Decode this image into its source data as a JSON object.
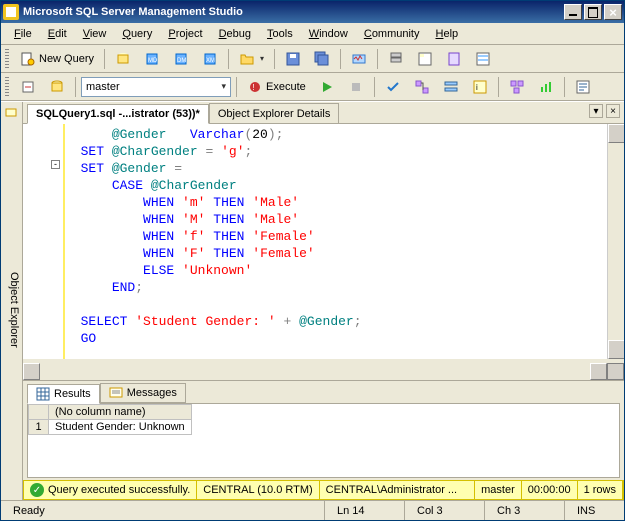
{
  "window": {
    "title": "Microsoft SQL Server Management Studio"
  },
  "menu": {
    "file": "File",
    "edit": "Edit",
    "view": "View",
    "query": "Query",
    "project": "Project",
    "debug": "Debug",
    "tools": "Tools",
    "window": "Window",
    "community": "Community",
    "help": "Help"
  },
  "toolbar1": {
    "new_query": "New Query"
  },
  "toolbar2": {
    "database": "master",
    "execute": "Execute"
  },
  "sidebar": {
    "object_explorer": "Object Explorer"
  },
  "tabs": {
    "active": "SQLQuery1.sql -...istrator (53))*",
    "inactive": "Object Explorer Details"
  },
  "editor": {
    "lines": [
      {
        "indent": 3,
        "tokens": [
          {
            "t": "var",
            "v": "@Gender"
          },
          {
            "t": "plain",
            "v": "   "
          },
          {
            "t": "kw",
            "v": "Varchar"
          },
          {
            "t": "gray",
            "v": "("
          },
          {
            "t": "plain",
            "v": "20"
          },
          {
            "t": "gray",
            "v": ");"
          }
        ]
      },
      {
        "indent": 1,
        "tokens": [
          {
            "t": "kw",
            "v": "SET"
          },
          {
            "t": "plain",
            "v": " "
          },
          {
            "t": "var",
            "v": "@CharGender"
          },
          {
            "t": "plain",
            "v": " "
          },
          {
            "t": "gray",
            "v": "="
          },
          {
            "t": "plain",
            "v": " "
          },
          {
            "t": "str",
            "v": "'g'"
          },
          {
            "t": "gray",
            "v": ";"
          }
        ]
      },
      {
        "indent": 1,
        "collapse": true,
        "tokens": [
          {
            "t": "kw",
            "v": "SET"
          },
          {
            "t": "plain",
            "v": " "
          },
          {
            "t": "var",
            "v": "@Gender"
          },
          {
            "t": "plain",
            "v": " "
          },
          {
            "t": "gray",
            "v": "="
          }
        ]
      },
      {
        "indent": 3,
        "tokens": [
          {
            "t": "kw",
            "v": "CASE"
          },
          {
            "t": "plain",
            "v": " "
          },
          {
            "t": "var",
            "v": "@CharGender"
          }
        ]
      },
      {
        "indent": 5,
        "tokens": [
          {
            "t": "kw",
            "v": "WHEN"
          },
          {
            "t": "plain",
            "v": " "
          },
          {
            "t": "str",
            "v": "'m'"
          },
          {
            "t": "plain",
            "v": " "
          },
          {
            "t": "kw",
            "v": "THEN"
          },
          {
            "t": "plain",
            "v": " "
          },
          {
            "t": "str",
            "v": "'Male'"
          }
        ]
      },
      {
        "indent": 5,
        "tokens": [
          {
            "t": "kw",
            "v": "WHEN"
          },
          {
            "t": "plain",
            "v": " "
          },
          {
            "t": "str",
            "v": "'M'"
          },
          {
            "t": "plain",
            "v": " "
          },
          {
            "t": "kw",
            "v": "THEN"
          },
          {
            "t": "plain",
            "v": " "
          },
          {
            "t": "str",
            "v": "'Male'"
          }
        ]
      },
      {
        "indent": 5,
        "tokens": [
          {
            "t": "kw",
            "v": "WHEN"
          },
          {
            "t": "plain",
            "v": " "
          },
          {
            "t": "str",
            "v": "'f'"
          },
          {
            "t": "plain",
            "v": " "
          },
          {
            "t": "kw",
            "v": "THEN"
          },
          {
            "t": "plain",
            "v": " "
          },
          {
            "t": "str",
            "v": "'Female'"
          }
        ]
      },
      {
        "indent": 5,
        "tokens": [
          {
            "t": "kw",
            "v": "WHEN"
          },
          {
            "t": "plain",
            "v": " "
          },
          {
            "t": "str",
            "v": "'F'"
          },
          {
            "t": "plain",
            "v": " "
          },
          {
            "t": "kw",
            "v": "THEN"
          },
          {
            "t": "plain",
            "v": " "
          },
          {
            "t": "str",
            "v": "'Female'"
          }
        ]
      },
      {
        "indent": 5,
        "tokens": [
          {
            "t": "kw",
            "v": "ELSE"
          },
          {
            "t": "plain",
            "v": " "
          },
          {
            "t": "str",
            "v": "'Unknown'"
          }
        ]
      },
      {
        "indent": 3,
        "tokens": [
          {
            "t": "kw",
            "v": "END"
          },
          {
            "t": "gray",
            "v": ";"
          }
        ]
      },
      {
        "indent": 1,
        "tokens": []
      },
      {
        "indent": 1,
        "tokens": [
          {
            "t": "kw",
            "v": "SELECT"
          },
          {
            "t": "plain",
            "v": " "
          },
          {
            "t": "str",
            "v": "'Student Gender: '"
          },
          {
            "t": "plain",
            "v": " "
          },
          {
            "t": "gray",
            "v": "+"
          },
          {
            "t": "plain",
            "v": " "
          },
          {
            "t": "var",
            "v": "@Gender"
          },
          {
            "t": "gray",
            "v": ";"
          }
        ]
      },
      {
        "indent": 1,
        "tokens": [
          {
            "t": "kw",
            "v": "GO"
          }
        ]
      }
    ]
  },
  "results": {
    "tab_results": "Results",
    "tab_messages": "Messages",
    "columns": [
      "(No column name)"
    ],
    "rows": [
      [
        "1",
        "Student Gender: Unknown"
      ]
    ]
  },
  "status_yellow": {
    "msg": "Query executed successfully.",
    "server": "CENTRAL (10.0 RTM)",
    "login": "CENTRAL\\Administrator ...",
    "db": "master",
    "time": "00:00:00",
    "rows": "1 rows"
  },
  "statusbar": {
    "ready": "Ready",
    "ln": "Ln 14",
    "col": "Col 3",
    "ch": "Ch 3",
    "ins": "INS"
  }
}
